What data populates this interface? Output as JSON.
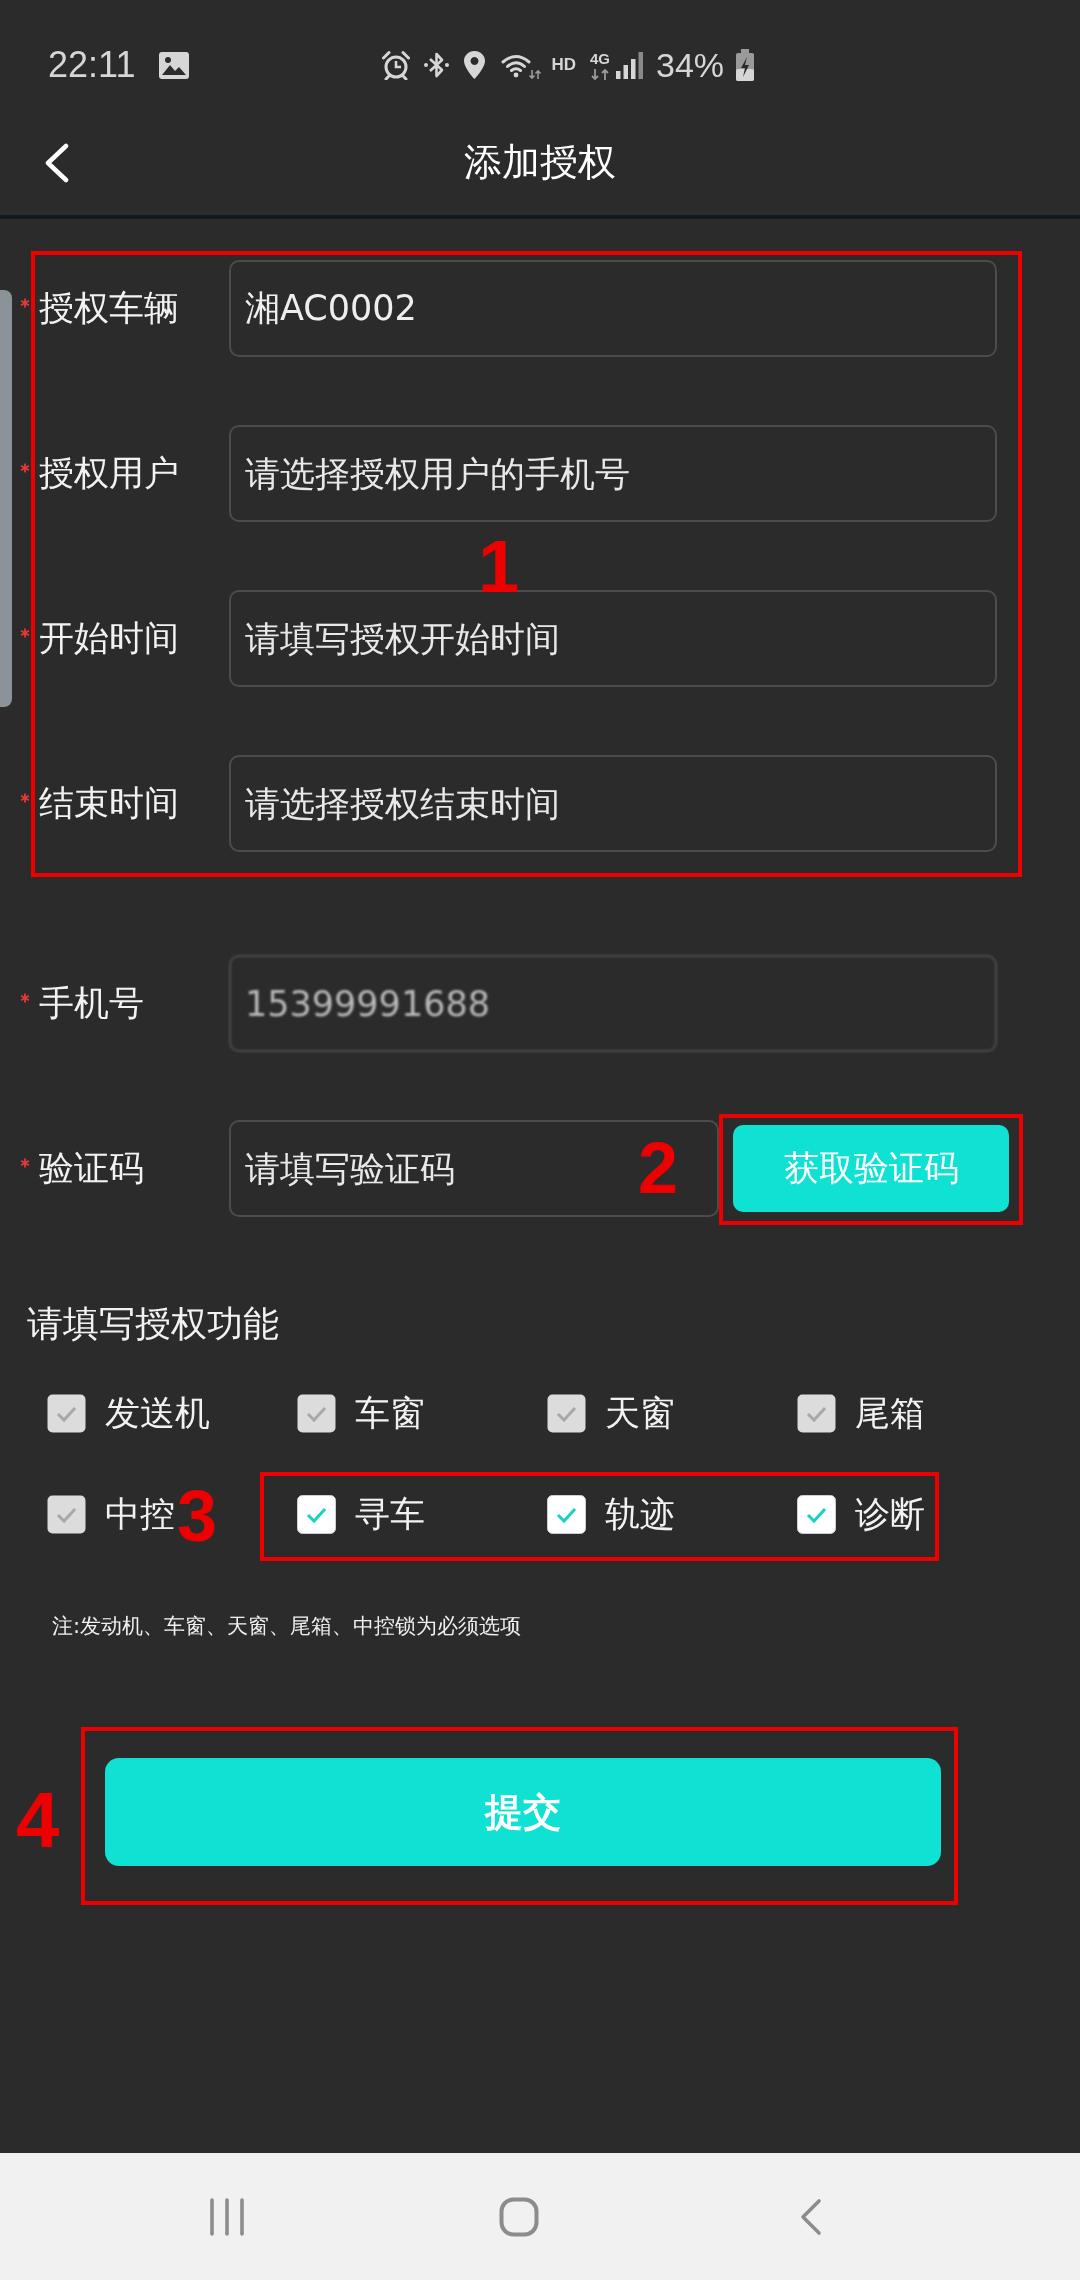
{
  "status_bar": {
    "time": "22:11",
    "hd_label": "HD",
    "network_label": "4G",
    "battery": "34%"
  },
  "header": {
    "title": "添加授权"
  },
  "form": {
    "fields": [
      {
        "label": "授权车辆",
        "required": true,
        "value": "湘AC0002"
      },
      {
        "label": "授权用户",
        "required": true,
        "placeholder": "请选择授权用户的手机号"
      },
      {
        "label": "开始时间",
        "required": true,
        "placeholder": "请填写授权开始时间"
      },
      {
        "label": "结束时间",
        "required": true,
        "placeholder": "请选择授权结束时间"
      },
      {
        "label": "手机号",
        "required": true,
        "value": "15399991688",
        "redacted": true
      },
      {
        "label": "验证码",
        "required": true,
        "placeholder": "请填写验证码",
        "button": "获取验证码"
      }
    ]
  },
  "functions": {
    "title": "请填写授权功能",
    "options": [
      {
        "label": "发送机",
        "checked": true,
        "disabled": true
      },
      {
        "label": "车窗",
        "checked": true,
        "disabled": true
      },
      {
        "label": "天窗",
        "checked": true,
        "disabled": true
      },
      {
        "label": "尾箱",
        "checked": true,
        "disabled": true
      },
      {
        "label": "中控",
        "checked": true,
        "disabled": true
      },
      {
        "label": "寻车",
        "checked": true,
        "disabled": false
      },
      {
        "label": "轨迹",
        "checked": true,
        "disabled": false
      },
      {
        "label": "诊断",
        "checked": true,
        "disabled": false
      }
    ],
    "note": "注:发动机、车窗、天窗、尾箱、中控锁为必须选项"
  },
  "submit_button": "提交",
  "annotations": [
    {
      "label": "1"
    },
    {
      "label": "2"
    },
    {
      "label": "3"
    },
    {
      "label": "4"
    }
  ]
}
